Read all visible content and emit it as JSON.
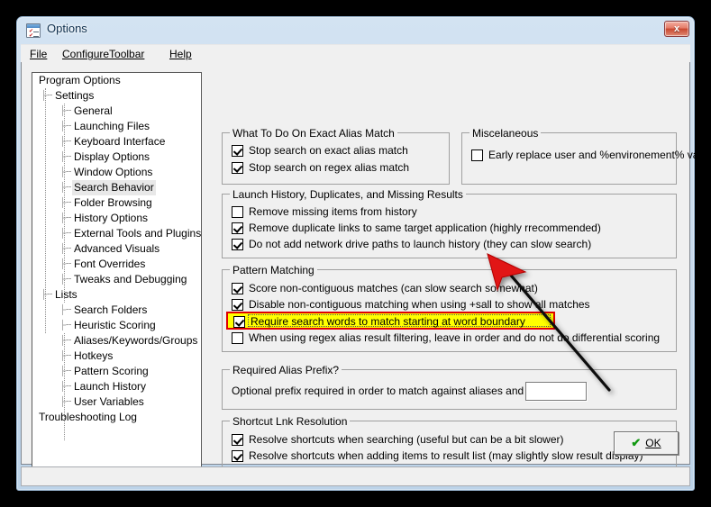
{
  "window": {
    "title": "Options",
    "icon": "options-checklist-icon",
    "close_label": "x",
    "accent_highlight": "#ffff00",
    "accent_highlight_border": "#e00000",
    "frame_color": "#cadcee"
  },
  "menubar": {
    "items": [
      {
        "name": "file",
        "label": "File",
        "accel": "F"
      },
      {
        "name": "configure-toolbar",
        "label": "ConfigureToolbar",
        "accel": "C"
      },
      {
        "name": "help",
        "label": "Help",
        "accel": "H"
      }
    ]
  },
  "tree": {
    "nodes": [
      {
        "label": "Program Options",
        "level": 0,
        "selected": false
      },
      {
        "label": "Settings",
        "level": 1,
        "selected": false
      },
      {
        "label": "General",
        "level": 2,
        "selected": false
      },
      {
        "label": "Launching Files",
        "level": 2,
        "selected": false
      },
      {
        "label": "Keyboard Interface",
        "level": 2,
        "selected": false
      },
      {
        "label": "Display Options",
        "level": 2,
        "selected": false
      },
      {
        "label": "Window Options",
        "level": 2,
        "selected": false
      },
      {
        "label": "Search Behavior",
        "level": 2,
        "selected": true
      },
      {
        "label": "Folder Browsing",
        "level": 2,
        "selected": false
      },
      {
        "label": "History Options",
        "level": 2,
        "selected": false
      },
      {
        "label": "External Tools and Plugins",
        "level": 2,
        "selected": false
      },
      {
        "label": "Advanced Visuals",
        "level": 2,
        "selected": false
      },
      {
        "label": "Font Overrides",
        "level": 2,
        "selected": false
      },
      {
        "label": "Tweaks and Debugging",
        "level": 2,
        "selected": false
      },
      {
        "label": "Lists",
        "level": 1,
        "selected": false
      },
      {
        "label": "Search Folders",
        "level": 2,
        "selected": false
      },
      {
        "label": "Heuristic Scoring",
        "level": 2,
        "selected": false
      },
      {
        "label": "Aliases/Keywords/Groups",
        "level": 2,
        "selected": false
      },
      {
        "label": "Hotkeys",
        "level": 2,
        "selected": false
      },
      {
        "label": "Pattern Scoring",
        "level": 2,
        "selected": false
      },
      {
        "label": "Launch History",
        "level": 2,
        "selected": false
      },
      {
        "label": "User Variables",
        "level": 2,
        "selected": false
      },
      {
        "label": "Troubleshooting Log",
        "level": 0,
        "selected": false
      }
    ]
  },
  "groups": {
    "exact_alias": {
      "caption": "What To Do On Exact Alias Match",
      "items": [
        {
          "label": "Stop search on exact alias match",
          "checked": true
        },
        {
          "label": "Stop search on regex alias match",
          "checked": true
        }
      ]
    },
    "misc": {
      "caption": "Miscelaneous",
      "items": [
        {
          "label": "Early replace user and %environement% vars",
          "checked": false
        }
      ]
    },
    "launch_history": {
      "caption": "Launch History, Duplicates, and Missing Results",
      "items": [
        {
          "label": "Remove missing items from history",
          "checked": false
        },
        {
          "label": "Remove duplicate links to same target application (highly rrecommended)",
          "checked": true
        },
        {
          "label": "Do not add network drive paths to launch history (they can slow search)",
          "checked": true
        }
      ]
    },
    "pattern_matching": {
      "caption": "Pattern Matching",
      "items": [
        {
          "label": "Score non-contiguous matches (can slow search somewhat)",
          "checked": true,
          "highlighted": false
        },
        {
          "label": "Disable non-contiguous matching when using +sall to show all matches",
          "checked": true,
          "highlighted": false
        },
        {
          "label": "Require search words to match starting at word boundary",
          "checked": true,
          "highlighted": true
        },
        {
          "label": "When using regex alias result filtering, leave in order and do not do differential scoring",
          "checked": false,
          "highlighted": false
        }
      ]
    },
    "alias_prefix": {
      "caption": "Required Alias Prefix?",
      "field_label": "Optional prefix required in order to match against aliases and plugins:",
      "field_value": "",
      "field_placeholder": ""
    },
    "shortcut_lnk": {
      "caption": "Shortcut Lnk Resolution",
      "items": [
        {
          "label": "Resolve shortcuts when searching (useful but can be a bit slower)",
          "checked": true
        },
        {
          "label": "Resolve shortcuts when adding items to result list (may slightly slow result display)",
          "checked": true
        }
      ]
    }
  },
  "footer": {
    "ok_label": "OK",
    "ok_accel": "O",
    "ok_icon": "green-check-icon"
  },
  "annotation": {
    "type": "red-arrow-pointer",
    "points_to": "Require search words to match starting at word boundary"
  }
}
